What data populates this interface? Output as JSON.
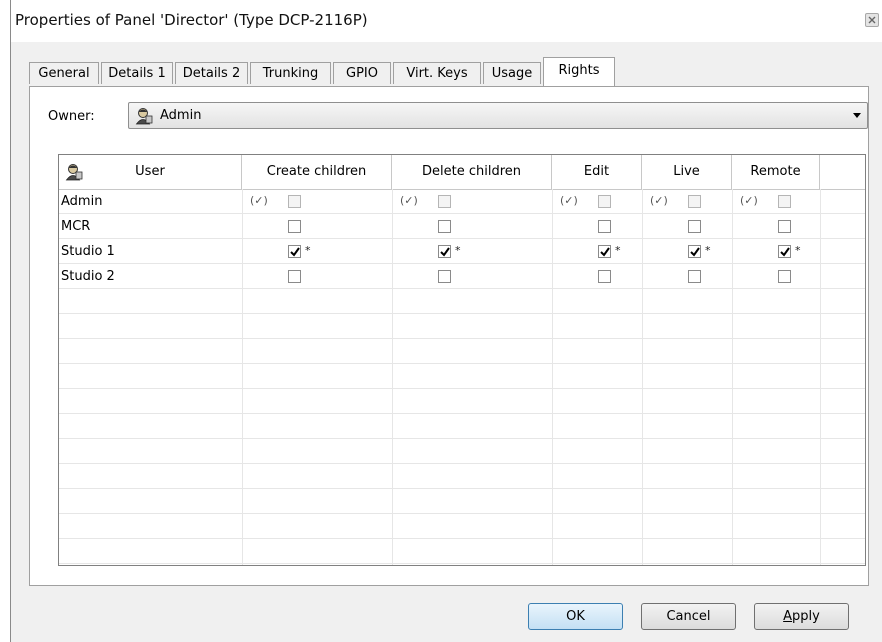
{
  "window": {
    "title": "Properties of Panel 'Director' (Type DCP-2116P)"
  },
  "tabs": [
    {
      "label": "General"
    },
    {
      "label": "Details 1"
    },
    {
      "label": "Details 2"
    },
    {
      "label": "Trunking"
    },
    {
      "label": "GPIO"
    },
    {
      "label": "Virt. Keys"
    },
    {
      "label": "Usage"
    },
    {
      "label": "Rights",
      "active": true
    }
  ],
  "owner": {
    "label": "Owner:",
    "value": "Admin",
    "icon": "user-icon"
  },
  "grid": {
    "columns": [
      "User",
      "Create children",
      "Delete children",
      "Edit",
      "Live",
      "Remote"
    ],
    "header_icon": "user-icon",
    "inherited_mark": "(✓)",
    "modified_mark": "*",
    "rows": [
      {
        "user": "Admin",
        "rights": [
          "inherited",
          "inherited",
          "inherited",
          "inherited",
          "inherited"
        ]
      },
      {
        "user": "MCR",
        "rights": [
          "unchecked",
          "unchecked",
          "unchecked",
          "unchecked",
          "unchecked"
        ]
      },
      {
        "user": "Studio 1",
        "rights": [
          "checked-modified",
          "checked-modified",
          "checked-modified",
          "checked-modified",
          "checked-modified"
        ]
      },
      {
        "user": "Studio 2",
        "rights": [
          "unchecked",
          "unchecked",
          "unchecked",
          "unchecked",
          "unchecked"
        ]
      }
    ]
  },
  "buttons": {
    "ok": "OK",
    "cancel": "Cancel",
    "apply": "Apply"
  }
}
